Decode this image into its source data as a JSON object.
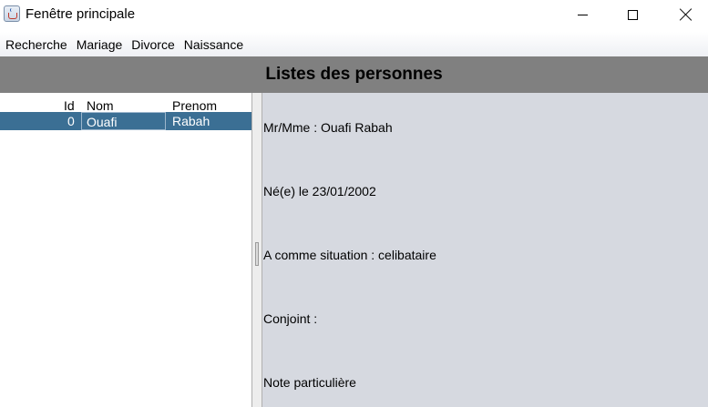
{
  "window": {
    "title": "Fenêtre principale",
    "icon": "java-cup-icon"
  },
  "menu": [
    {
      "label": "Recherche"
    },
    {
      "label": "Mariage"
    },
    {
      "label": "Divorce"
    },
    {
      "label": "Naissance"
    }
  ],
  "header": {
    "title": "Listes des personnes"
  },
  "table": {
    "columns": [
      "Id",
      "Nom",
      "Prenom"
    ],
    "rows": [
      {
        "id": "0",
        "nom": "Ouafi",
        "prenom": "Rabah"
      }
    ]
  },
  "details": {
    "line1": "Mr/Mme : Ouafi Rabah",
    "line2": "Né(e) le 23/01/2002",
    "line3": "A comme situation : celibataire",
    "line4": "Conjoint :",
    "line5": "Note particulière"
  },
  "colors": {
    "header_bg": "#808080",
    "selected_row": "#3b6f94",
    "detail_bg": "#d6d9e0"
  }
}
